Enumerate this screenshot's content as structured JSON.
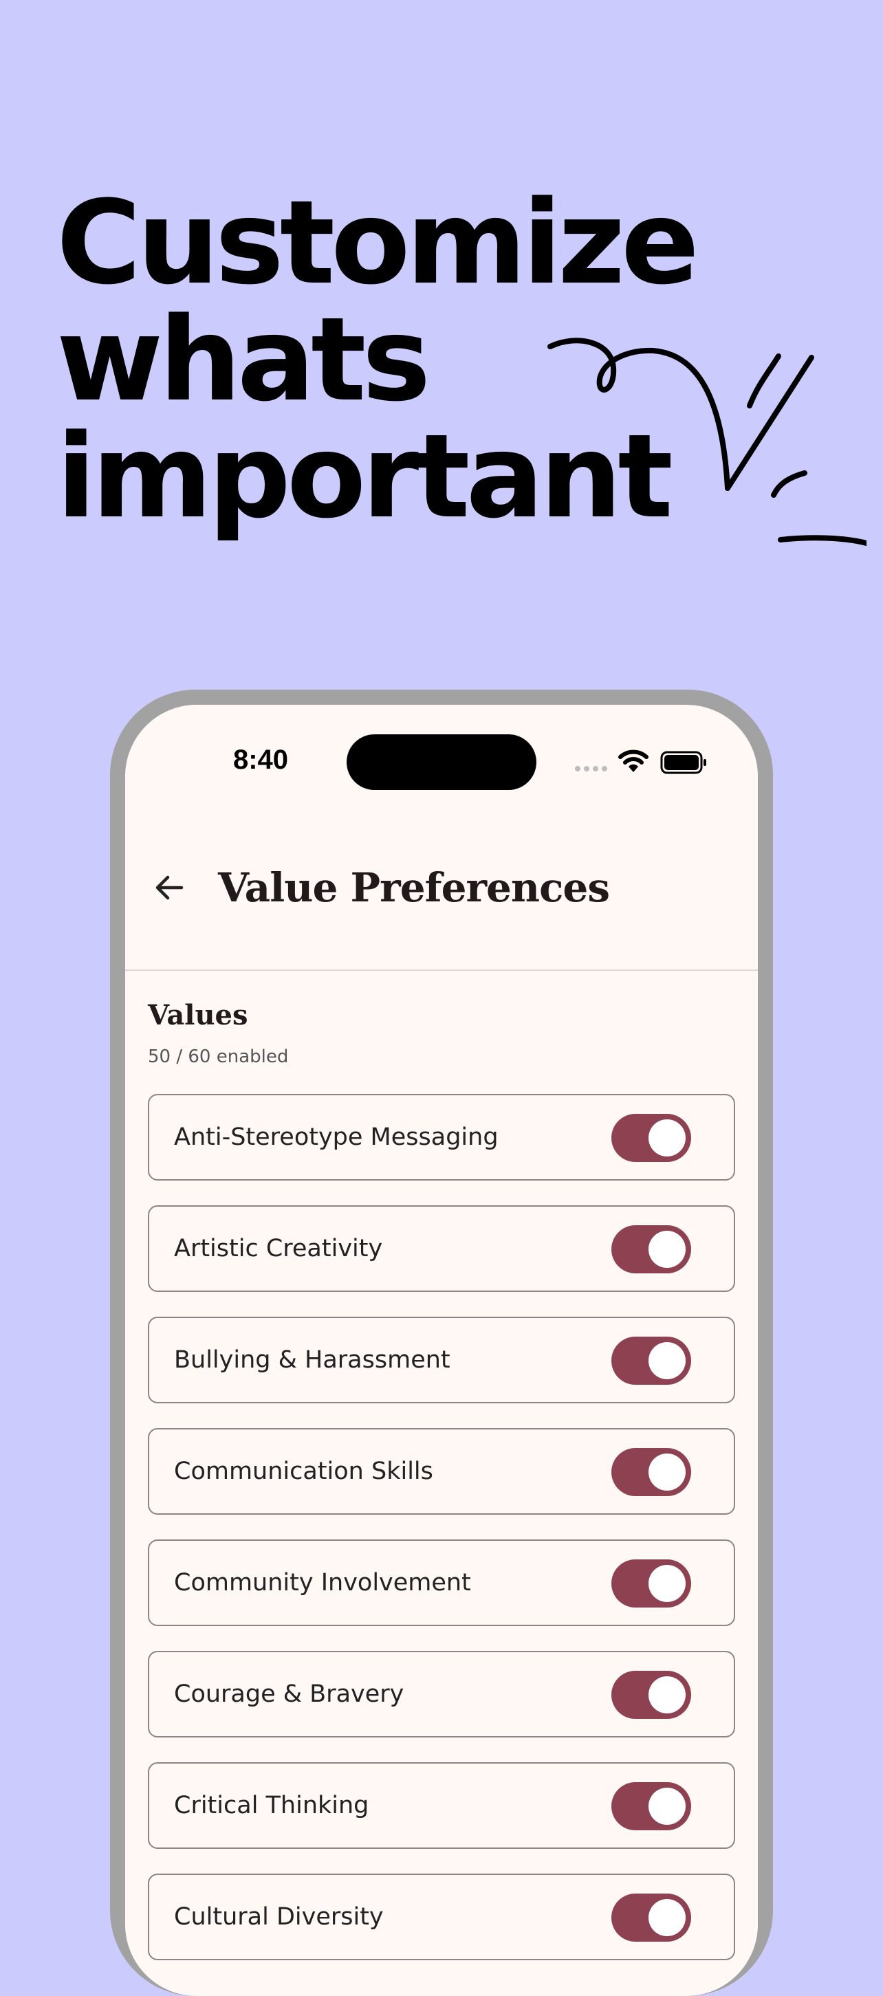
{
  "headline": {
    "lines": [
      "Customize",
      "whats",
      "important"
    ]
  },
  "status_bar": {
    "time": "8:40"
  },
  "header": {
    "title": "Value Preferences"
  },
  "section": {
    "title": "Values",
    "count": "50 / 60 enabled"
  },
  "values": [
    {
      "label": "Anti-Stereotype Messaging",
      "enabled": true
    },
    {
      "label": "Artistic Creativity",
      "enabled": true
    },
    {
      "label": "Bullying & Harassment",
      "enabled": true
    },
    {
      "label": "Communication Skills",
      "enabled": true
    },
    {
      "label": "Community Involvement",
      "enabled": true
    },
    {
      "label": "Courage & Bravery",
      "enabled": true
    },
    {
      "label": "Critical Thinking",
      "enabled": true
    },
    {
      "label": "Cultural Diversity",
      "enabled": true
    }
  ],
  "colors": {
    "background": "#CCCBFD",
    "toggle_on": "#8E4150",
    "screen": "#FFF8F5"
  }
}
